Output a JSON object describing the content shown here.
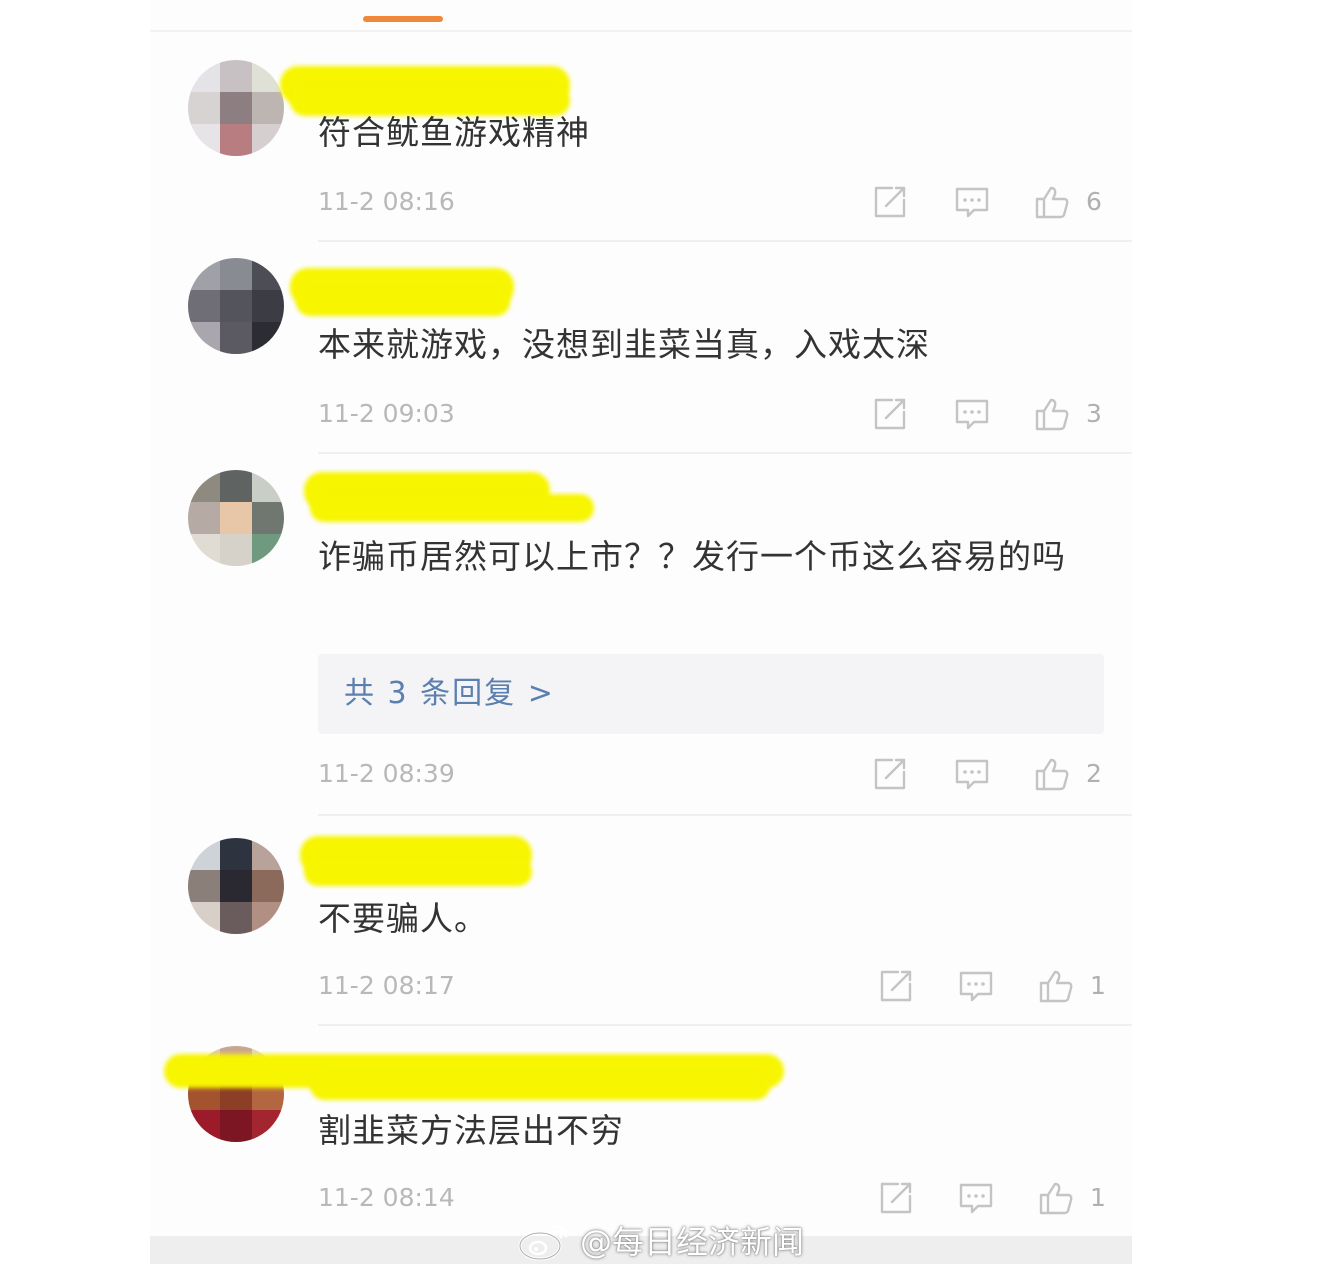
{
  "colors": {
    "accent": "#f0883a",
    "highlight": "#f7f500",
    "reply_link": "#5b7fae",
    "meta_text": "#b8b8b8"
  },
  "icons": {
    "share": "share-icon",
    "comment": "comment-icon",
    "like": "thumbs-up-icon",
    "weibo": "weibo-logo-icon"
  },
  "comments": [
    {
      "text": "符合鱿鱼游戏精神",
      "time": "11-2 08:16",
      "likes": "6",
      "avatar_colors": [
        "#e4e4e8",
        "#c7c1c4",
        "#dfe0d6",
        "#d8d3d3",
        "#8d7f81",
        "#bdb5b1",
        "#e6e4e6",
        "#b87d80",
        "#d5cfd0"
      ]
    },
    {
      "text": "本来就游戏，没想到韭菜当真，入戏太深",
      "time": "11-2 09:03",
      "likes": "3",
      "avatar_colors": [
        "#9fa0a8",
        "#898b93",
        "#4c4d55",
        "#6f6e77",
        "#53545c",
        "#3b3c44",
        "#a9a7ad",
        "#5b5a62",
        "#2c2d33"
      ]
    },
    {
      "text": "诈骗币居然可以上市？？发行一个币这么容易的吗",
      "time": "11-2 08:39",
      "likes": "2",
      "replies_label": "共 3 条回复 >",
      "avatar_colors": [
        "#8f8a80",
        "#5f6463",
        "#c9cec6",
        "#b6aba4",
        "#e7c7a8",
        "#6f7770",
        "#e0dcd4",
        "#d6d2ca",
        "#6f9a80"
      ]
    },
    {
      "text": "不要骗人。",
      "time": "11-2 08:17",
      "likes": "1",
      "avatar_colors": [
        "#ced3d8",
        "#2e3340",
        "#b7a39a",
        "#8b7f7a",
        "#2a2830",
        "#8b6a5c",
        "#d8cfc9",
        "#6a5c5d",
        "#b18f82"
      ]
    },
    {
      "text": "割韭菜方法层出不穷",
      "time": "11-2 08:14",
      "likes": "1",
      "avatar_colors": [
        "#d9c8b8",
        "#c9a692",
        "#e0d4c8",
        "#a4532f",
        "#8d3e26",
        "#b3663f",
        "#9b1b2a",
        "#7c1622",
        "#a22530"
      ]
    }
  ],
  "watermark": "@每日经济新闻"
}
